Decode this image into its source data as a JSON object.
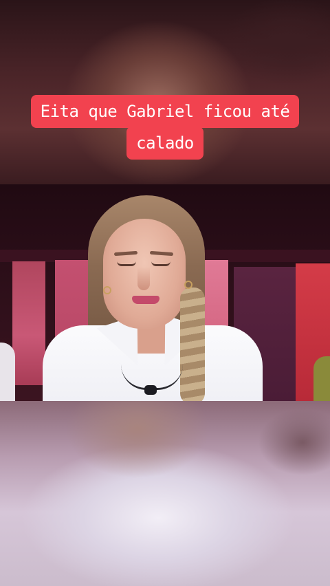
{
  "caption": {
    "line1": "Eita que Gabriel ficou até",
    "line2": "calado",
    "bg_color": "#f2424f",
    "text_color": "#ffffff"
  }
}
